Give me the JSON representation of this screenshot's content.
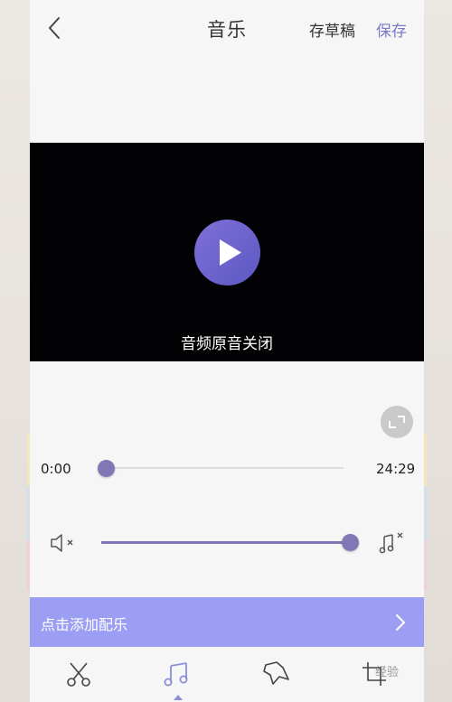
{
  "header": {
    "title": "音乐",
    "draft_label": "存草稿",
    "save_label": "保存"
  },
  "video": {
    "caption": "音频原音关闭"
  },
  "timeline": {
    "start_time": "0:00",
    "end_time": "24:29",
    "progress": 0.0
  },
  "volume": {
    "level": 1.0
  },
  "add_music": {
    "label": "点击添加配乐"
  },
  "bottom_tabs": [
    {
      "icon": "scissors-icon",
      "active": false
    },
    {
      "icon": "music-note-icon",
      "active": true
    },
    {
      "icon": "sticker-icon",
      "active": false
    },
    {
      "icon": "crop-icon",
      "active": false
    }
  ],
  "watermark": "经验",
  "colors": {
    "accent": "#7b7bc8",
    "play_button": "#6a63cc",
    "add_music_bar": "#9c9ef3",
    "slider": "#8078b4"
  }
}
